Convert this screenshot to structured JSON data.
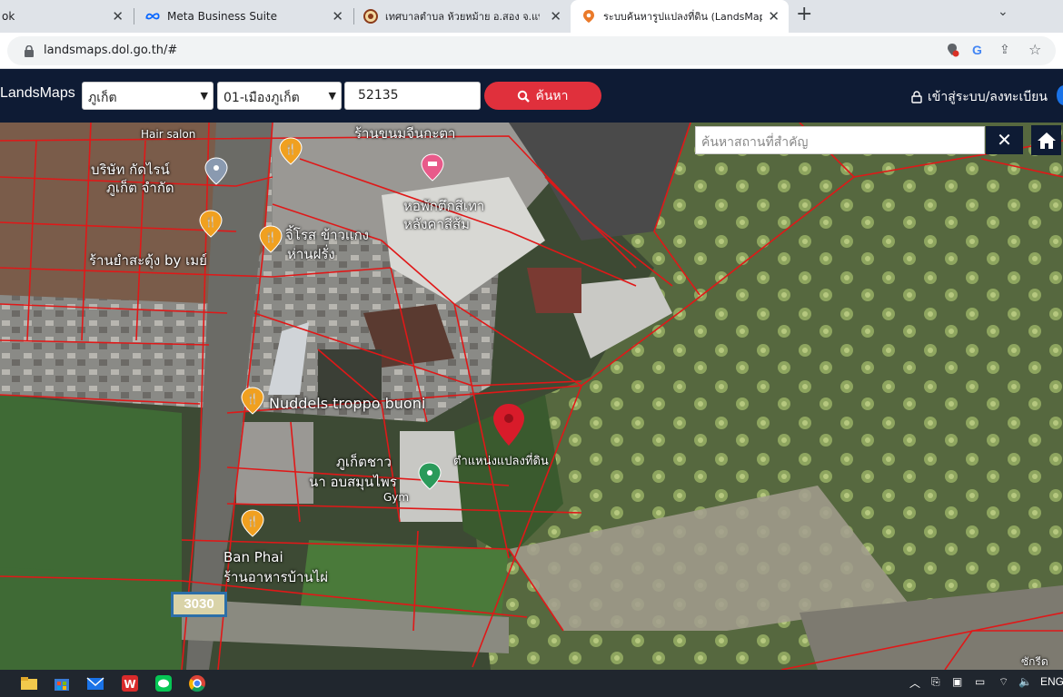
{
  "browser": {
    "tabs": [
      {
        "title": "ok",
        "icon": "facebook-icon",
        "active": false
      },
      {
        "title": "Meta Business Suite",
        "icon": "meta-icon",
        "active": false
      },
      {
        "title": "เทศบาลตำบล ห้วยหม้าย อ.สอง จ.แพร่",
        "icon": "seal-icon",
        "active": false
      },
      {
        "title": "ระบบค้นหารูปแปลงที่ดิน (LandsMaps",
        "icon": "map-pin-icon",
        "active": true
      }
    ],
    "url": "landsmaps.dol.go.th/#"
  },
  "app": {
    "brand": "LandsMaps",
    "province": "ภูเก็ต",
    "district": "01-เมืองภูเก็ต",
    "parcel_number": "52135",
    "search_label": "ค้นหา",
    "login_label": "เข้าสู่ระบบ/ลงทะเบียน",
    "place_search_placeholder": "ค้นหาสถานที่สำคัญ",
    "accent_color": "#e0303c",
    "nav_color": "#0e1b34"
  },
  "map": {
    "labels": {
      "hair_salon": "Hair salon",
      "shop_top": "ร้านขนมจีนกะตา",
      "company_1": "บริษัท กัดไรน์",
      "company_2": "ภูเก็ต จำกัด",
      "dorm_1": "หอพักตึกสีเทา",
      "dorm_2": "หลังคาสีส้ม",
      "jirot_1": "จิ้โรส ข้าวแกง",
      "jirot_2": "ห่านฝรั่ง",
      "yam": "ร้านยำสะดุ้ง by เมย์",
      "nuddels": "Nuddels troppo buoni",
      "parcel_location": "ตำแหน่งแปลงที่ดิน",
      "gym_1": "ภูเก็ตชาว",
      "gym_2": "นา อบสมุนไพร",
      "gym_3": "Gym",
      "banphai_1": "Ban Phai",
      "banphai_2": "ร้านอาหารบ้านไผ่",
      "route_number": "3030",
      "corner": "ซักรีด"
    }
  },
  "taskbar": {
    "language": "ENG"
  }
}
